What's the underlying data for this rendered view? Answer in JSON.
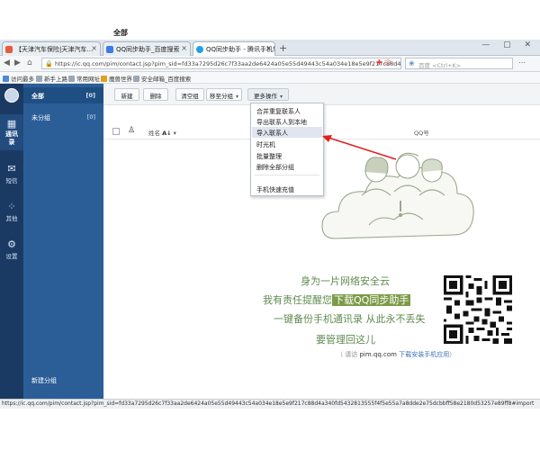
{
  "browser": {
    "tabs": [
      {
        "label": "【天津汽车保险|天津汽车…",
        "fav_color": "#e85a3c"
      },
      {
        "label": "QQ同步助手_百度搜索",
        "fav_color": "#3c7be8"
      },
      {
        "label": "QQ同步助手 - 腾讯手机软…",
        "fav_color": "#22a0e6"
      }
    ],
    "tab_close": "×",
    "new_tab": "+",
    "window_controls": "— ▢ ✕",
    "back": "◀",
    "forward": "▶",
    "home": "⌂",
    "address": "https://ic.qq.com/pim/contact.jsp?pim_sid=fd33a7295d26c7f33aa2de6424a05e55d49443c54a034e18e5e9f217c88d4a340fd54",
    "address_icons": "✚ ⬡",
    "search_placeholder": "百度 <Ctrl+K>",
    "right_icons": "⋯",
    "bookmarks": [
      {
        "label": "访问最多",
        "color": "#4a8ad6"
      },
      {
        "label": "新手上路",
        "color": "#9aa8b5"
      },
      {
        "label": "常用网址",
        "color": "#9aa8b5"
      },
      {
        "label": "魔兽世界",
        "color": "#e0a020"
      },
      {
        "label": "安全邮箱_百度搜索",
        "color": "#9aa8b5"
      }
    ]
  },
  "sidebar": {
    "items": [
      {
        "label": "通讯录",
        "icon": "▦"
      },
      {
        "label": "短信",
        "icon": "✉"
      },
      {
        "label": "其他",
        "icon": "⁘"
      },
      {
        "label": "设置",
        "icon": "⚙"
      }
    ]
  },
  "groups": {
    "items": [
      {
        "label": "全部",
        "count": "[0]"
      },
      {
        "label": "未分组",
        "count": "[0]"
      }
    ],
    "new_group": "新建分组",
    "plus": "+"
  },
  "toolbar": {
    "new": "新建",
    "delete": "删除",
    "clear_group": "清空组",
    "move_group": "移至分组",
    "more": "更多操作",
    "caret": "▾"
  },
  "list": {
    "title": "全部",
    "name_col": "姓名",
    "sort": "A↓",
    "qq_col": "QQ号",
    "person_icon": "♙"
  },
  "menu": {
    "items": [
      "合并重复联系人",
      "导出联系人到本地",
      "导入联系人",
      "时光机",
      "批量整理",
      "删除全部分组",
      "手机快速充值"
    ]
  },
  "promo": {
    "line1": "身为一片网络安全云",
    "line2_pre": "我有责任提醒您",
    "line2_hl": "下载QQ同步助手",
    "line3": "一键备份手机通讯录 从此永不丢失",
    "line4": "要管理回这儿",
    "hint_pre": "（ 请访",
    "hint_url": "pim.qq.com",
    "hint_link": "下载安装手机应用",
    "hint_post": "）"
  },
  "status": {
    "url": "https://ic.qq.com/pim/contact.jsp?pim_sid=fd33a7295d26c7f33aa2de6424a05e55d49443c54a034e18e5e9f217c88d4a340fd5432813555f4f5e55a7a8dde2e75dcbbff58e2180d53257e89ff8#import"
  },
  "colors": {
    "sidebar": "#1b3a63",
    "groups": "#2b5e97",
    "accent_green": "#5f8a50",
    "arrow": "#e02020"
  }
}
